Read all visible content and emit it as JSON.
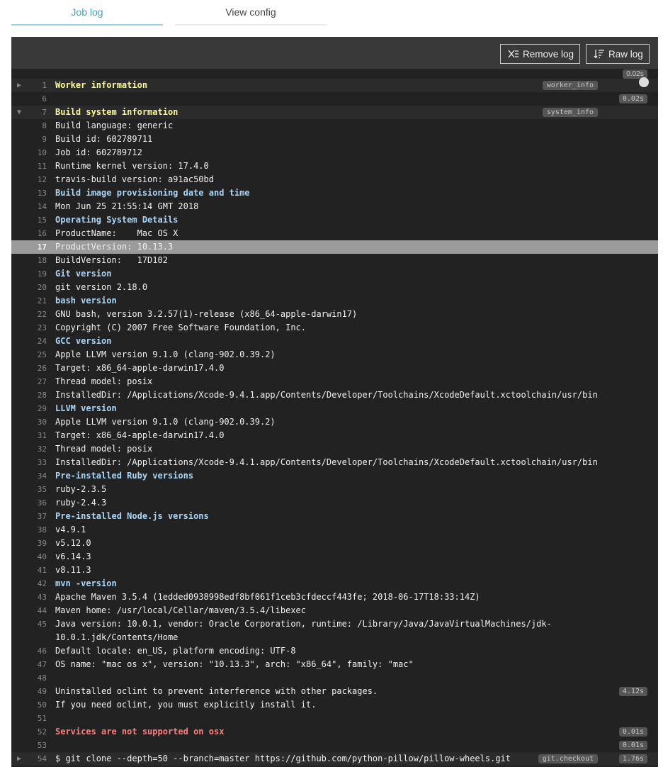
{
  "tabs": {
    "job_log": "Job log",
    "view_config": "View config"
  },
  "toolbar": {
    "remove_log": "Remove log",
    "raw_log": "Raw log"
  },
  "log": {
    "top_time": "0.02s",
    "lines": [
      {
        "n": "1",
        "text": "Worker information",
        "style": "yellow",
        "fold": true,
        "arrow": "▶",
        "tag": "worker_info"
      },
      {
        "n": "6",
        "text": "",
        "time": "0.02s"
      },
      {
        "n": "7",
        "text": "Build system information",
        "style": "yellow",
        "fold": true,
        "arrow": "▼",
        "tag": "system_info"
      },
      {
        "n": "8",
        "text": "Build language: generic"
      },
      {
        "n": "9",
        "text": "Build id: 602789711"
      },
      {
        "n": "10",
        "text": "Job id: 602789712"
      },
      {
        "n": "11",
        "text": "Runtime kernel version: 17.4.0"
      },
      {
        "n": "12",
        "text": "travis-build version: a91ac50bd"
      },
      {
        "n": "13",
        "text": "Build image provisioning date and time",
        "style": "blue"
      },
      {
        "n": "14",
        "text": "Mon Jun 25 21:55:14 GMT 2018"
      },
      {
        "n": "15",
        "text": "Operating System Details",
        "style": "blue"
      },
      {
        "n": "16",
        "text": "ProductName:    Mac OS X"
      },
      {
        "n": "17",
        "text": "ProductVersion: 10.13.3",
        "highlight": true
      },
      {
        "n": "18",
        "text": "BuildVersion:   17D102"
      },
      {
        "n": "19",
        "text": "Git version",
        "style": "blue"
      },
      {
        "n": "20",
        "text": "git version 2.18.0"
      },
      {
        "n": "21",
        "text": "bash version",
        "style": "blue"
      },
      {
        "n": "22",
        "text": "GNU bash, version 3.2.57(1)-release (x86_64-apple-darwin17)"
      },
      {
        "n": "23",
        "text": "Copyright (C) 2007 Free Software Foundation, Inc."
      },
      {
        "n": "24",
        "text": "GCC version",
        "style": "blue"
      },
      {
        "n": "25",
        "text": "Apple LLVM version 9.1.0 (clang-902.0.39.2)"
      },
      {
        "n": "26",
        "text": "Target: x86_64-apple-darwin17.4.0"
      },
      {
        "n": "27",
        "text": "Thread model: posix"
      },
      {
        "n": "28",
        "text": "InstalledDir: /Applications/Xcode-9.4.1.app/Contents/Developer/Toolchains/XcodeDefault.xctoolchain/usr/bin"
      },
      {
        "n": "29",
        "text": "LLVM version",
        "style": "blue"
      },
      {
        "n": "30",
        "text": "Apple LLVM version 9.1.0 (clang-902.0.39.2)"
      },
      {
        "n": "31",
        "text": "Target: x86_64-apple-darwin17.4.0"
      },
      {
        "n": "32",
        "text": "Thread model: posix"
      },
      {
        "n": "33",
        "text": "InstalledDir: /Applications/Xcode-9.4.1.app/Contents/Developer/Toolchains/XcodeDefault.xctoolchain/usr/bin"
      },
      {
        "n": "34",
        "text": "Pre-installed Ruby versions",
        "style": "blue"
      },
      {
        "n": "35",
        "text": "ruby-2.3.5"
      },
      {
        "n": "36",
        "text": "ruby-2.4.3"
      },
      {
        "n": "37",
        "text": "Pre-installed Node.js versions",
        "style": "blue"
      },
      {
        "n": "38",
        "text": "v4.9.1"
      },
      {
        "n": "39",
        "text": "v5.12.0"
      },
      {
        "n": "40",
        "text": "v6.14.3"
      },
      {
        "n": "41",
        "text": "v8.11.3"
      },
      {
        "n": "42",
        "text": "mvn -version",
        "style": "blue"
      },
      {
        "n": "43",
        "text": "Apache Maven 3.5.4 (1edded0938998edf8bf061f1ceb3cfdeccf443fe; 2018-06-17T18:33:14Z)"
      },
      {
        "n": "44",
        "text": "Maven home: /usr/local/Cellar/maven/3.5.4/libexec"
      },
      {
        "n": "45",
        "text": "Java version: 10.0.1, vendor: Oracle Corporation, runtime: /Library/Java/JavaVirtualMachines/jdk-",
        "cont": "10.0.1.jdk/Contents/Home"
      },
      {
        "n": "46",
        "text": "Default locale: en_US, platform encoding: UTF-8"
      },
      {
        "n": "47",
        "text": "OS name: \"mac os x\", version: \"10.13.3\", arch: \"x86_64\", family: \"mac\""
      },
      {
        "n": "48",
        "text": ""
      },
      {
        "n": "49",
        "text": "Uninstalled oclint to prevent interference with other packages.",
        "time": "4.12s"
      },
      {
        "n": "50",
        "text": "If you need oclint, you must explicitly install it."
      },
      {
        "n": "51",
        "text": ""
      },
      {
        "n": "52",
        "text": "Services are not supported on osx",
        "style": "red",
        "time": "0.01s"
      },
      {
        "n": "53",
        "text": "",
        "time": "0.01s"
      },
      {
        "n": "54",
        "text": "$ git clone --depth=50 --branch=master https://github.com/python-pillow/pillow-wheels.git",
        "fold": true,
        "arrow": "▶",
        "tag": "git.checkout",
        "time": "1.76s"
      }
    ]
  }
}
